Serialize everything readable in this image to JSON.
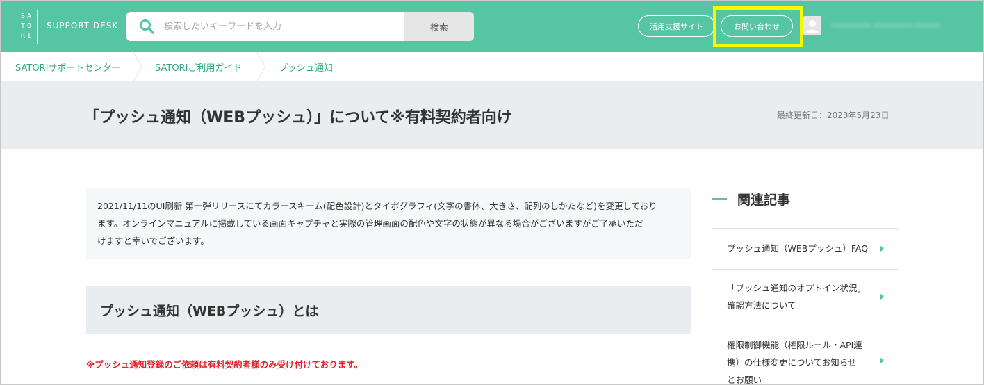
{
  "header": {
    "logo_text": "SATORI",
    "logo_lines": [
      "SA",
      "TO",
      "RI"
    ],
    "brand_label": "SUPPORT DESK",
    "search": {
      "placeholder": "検索したいキーワードを入力",
      "value": "",
      "button_label": "検索"
    },
    "support_site_label": "活用支援サイト",
    "contact_label": "お問い合わせ",
    "highlight_color": "#f8f800",
    "accent_color": "#55c5a2"
  },
  "breadcrumb": {
    "items": [
      {
        "label": "SATORIサポートセンター"
      },
      {
        "label": "SATORIご利用ガイド"
      },
      {
        "label": "プッシュ通知"
      }
    ]
  },
  "page": {
    "title": "「プッシュ通知（WEBプッシュ）」について※有料契約者向け",
    "updated": "最終更新日：2023年5月23日"
  },
  "main": {
    "notice_lines": [
      "2021/11/11のUI刷新 第一弾リリースにてカラースキーム(配色設計)とタイポグラフィ(文字の書体、大きさ、配列のしかたなど)を変更しており",
      "ます。オンラインマニュアルに掲載している画面キャプチャと実際の管理画面の配色や文字の状態が異なる場合がございますがご了承いただ",
      "けますと幸いでございます。"
    ],
    "section_title": "プッシュ通知（WEBプッシュ）とは",
    "warning": "※プッシュ通知登録のご依頼は有料契約者様のみ受け付けております。",
    "warning_color": "#e2232d"
  },
  "sidebar": {
    "title": "関連記事",
    "items": [
      {
        "label": "プッシュ通知（WEBプッシュ）FAQ"
      },
      {
        "label": "「プッシュ通知のオプトイン状況」\n確認方法について"
      },
      {
        "label": "権限制御機能（権限ルール・API連\n携）の仕様変更についてお知らせ\nとお願い"
      }
    ]
  }
}
